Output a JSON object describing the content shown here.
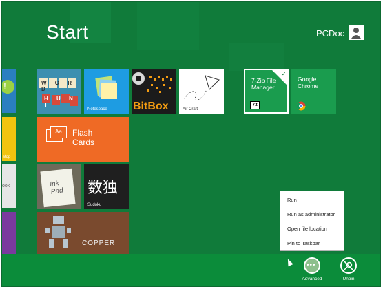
{
  "start": {
    "title": "Start"
  },
  "user": {
    "name": "PCDoc"
  },
  "tiles": {
    "word_hunt": {
      "letters_row1": "W O R D",
      "letters_row2": "H U N T"
    },
    "notespace": {
      "label": "Notespace"
    },
    "bitbox": {
      "label": "BitBox"
    },
    "aircraft": {
      "label": "Air Craft"
    },
    "zip": {
      "name": "7-Zip File Manager",
      "icon_text": "7z"
    },
    "chrome": {
      "name": "Google Chrome"
    },
    "flashcards": {
      "icon_text": "Aa",
      "label": "Flash Cards"
    },
    "inkpad": {
      "text": "Ink Pad"
    },
    "sudoku": {
      "glyphs": "数独",
      "label": "Sudoku"
    },
    "copper": {
      "label": "COPPER"
    },
    "left_partial": {
      "stop_text": "stop",
      "book_text": "ook"
    }
  },
  "context_menu": {
    "items": [
      "Run",
      "Run as administrator",
      "Open file location",
      "Pin to Taskbar"
    ]
  },
  "appbar": {
    "advanced_label": "Advanced",
    "unpin_label": "Unpin"
  },
  "colors": {
    "background": "#107b3a",
    "appbar": "#0b8c3a",
    "flashcards": "#ef6a25",
    "notespace": "#1e9ce2",
    "zip_tile": "#1a9c4e",
    "chrome_tile": "#1a9c4e"
  }
}
